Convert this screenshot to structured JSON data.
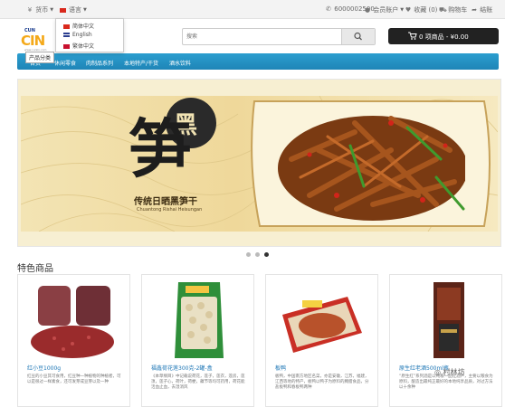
{
  "topbar": {
    "currency": "货币",
    "language": "语言",
    "phone": "6000002500",
    "account": "会员账户",
    "wishlist": "收藏 (0)",
    "cart_link": "购物车",
    "checkout": "结账"
  },
  "language_menu": {
    "options": [
      {
        "label": "简体中文",
        "flag": "cn"
      },
      {
        "label": "English",
        "flag": "uk"
      },
      {
        "label": "繁体中文",
        "flag": "hk"
      }
    ]
  },
  "logo": {
    "top": "CUN",
    "main": "CIN",
    "sub": "www.cunlin.com"
  },
  "search": {
    "placeholder": "搜索",
    "icon": "search-icon"
  },
  "cart": {
    "label": "0 项商品 - ¥0.00",
    "icon": "cart-icon"
  },
  "tooltip": "产品分类",
  "nav": {
    "items": [
      "首页",
      "休闲零食",
      "肉制品系列",
      "本地特产/干货",
      "酒水饮料"
    ]
  },
  "banner": {
    "calligraphy_main": "笋",
    "calligraphy_small": "黑",
    "caption": "传统日晒黑笋干",
    "caption_en": "Chuantong Rishai Heisungan",
    "slides": 3,
    "active_slide": 3
  },
  "featured": {
    "title": "特色商品",
    "products": [
      {
        "name": "红小豆1000g",
        "desc": "红豆的小豆其可食用，红豆种一种植物的种植者，可以是很过一样素食，还可发芽成豆芽以及一种"
      },
      {
        "name": "福鑫荷花莲300克-2罐-盒",
        "desc": "《本草纲目》中记载说荷花，莲子，莲衣，莲房，莲须，莲子心，荷叶，荷梗，藕节等均可药用，荷花能活血止血，去湿消风"
      },
      {
        "name": "板鸭",
        "desc": "板鸭，中国南方地区名菜，亦是安徽，江苏，福建，江西等地的特产，板鸭以鸭子为原料的腌腊食品，分盐板鸭和春板鸭两种"
      },
      {
        "name": "原生红老酒500ml瓶",
        "desc": "“原生红”系列酒是以纯粮一品红酒产，主要以粮食为原料，酿造出最纯正最好的本地纯享品质，对过方法以十余种"
      }
    ]
  },
  "watermark": "村林坊",
  "colors": {
    "nav_blue": "#2196c9",
    "link_blue": "#1b75b5",
    "cart_black": "#222222"
  }
}
